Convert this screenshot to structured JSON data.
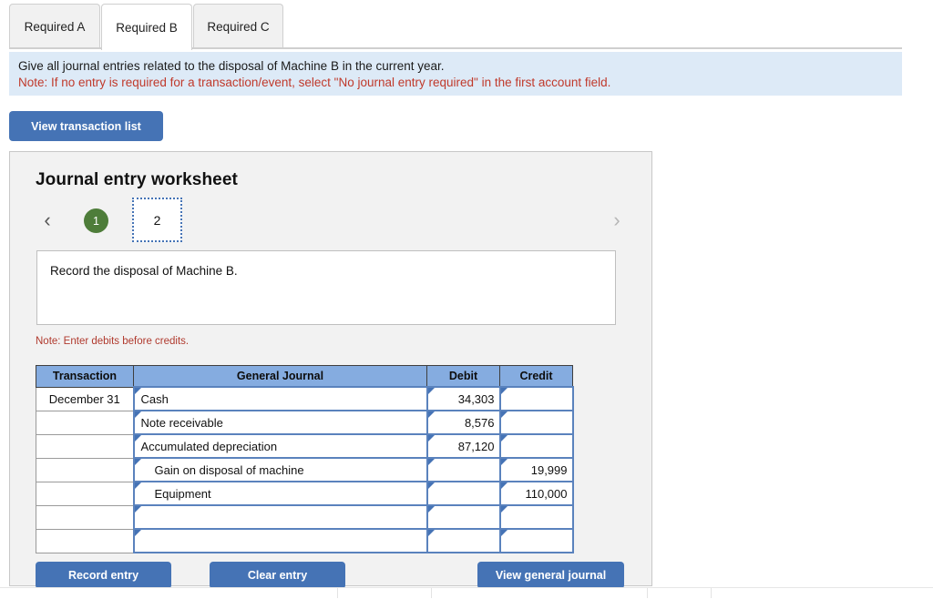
{
  "tabs": [
    {
      "label": "Required A",
      "active": false
    },
    {
      "label": "Required B",
      "active": true
    },
    {
      "label": "Required C",
      "active": false
    }
  ],
  "banner": {
    "line1": "Give all journal entries related to the disposal of Machine B in the current year.",
    "line2": "Note: If no entry is required for a transaction/event, select \"No journal entry required\" in the first account field.",
    "background_color": "#ddeaf7",
    "line2_color": "#c0392b"
  },
  "toolbar": {
    "view_transaction_list_label": "View transaction list",
    "button_color": "#4573b5"
  },
  "worksheet": {
    "title": "Journal entry worksheet",
    "pager": {
      "prev_icon": "chevron-left-icon",
      "next_icon": "chevron-right-icon",
      "pages": [
        {
          "label": "1",
          "state": "completed"
        },
        {
          "label": "2",
          "state": "selected"
        }
      ],
      "completed_color": "#4e7d3a",
      "selected_border_color": "#4573b5"
    },
    "prompt": "Record the disposal of Machine B.",
    "note": "Note: Enter debits before credits.",
    "table": {
      "headers": [
        "Transaction",
        "General Journal",
        "Debit",
        "Credit"
      ],
      "header_color": "#85ace0",
      "rows": [
        {
          "transaction": "December 31",
          "account": "Cash",
          "indent": false,
          "debit": "34,303",
          "credit": ""
        },
        {
          "transaction": "",
          "account": "Note receivable",
          "indent": false,
          "debit": "8,576",
          "credit": ""
        },
        {
          "transaction": "",
          "account": "Accumulated depreciation",
          "indent": false,
          "debit": "87,120",
          "credit": ""
        },
        {
          "transaction": "",
          "account": "Gain on disposal of machine",
          "indent": true,
          "debit": "",
          "credit": "19,999"
        },
        {
          "transaction": "",
          "account": "Equipment",
          "indent": true,
          "debit": "",
          "credit": "110,000"
        },
        {
          "transaction": "",
          "account": "",
          "indent": false,
          "debit": "",
          "credit": ""
        },
        {
          "transaction": "",
          "account": "",
          "indent": false,
          "debit": "",
          "credit": ""
        }
      ]
    },
    "actions": {
      "record_entry_label": "Record entry",
      "clear_entry_label": "Clear entry",
      "view_general_journal_label": "View general journal"
    }
  }
}
